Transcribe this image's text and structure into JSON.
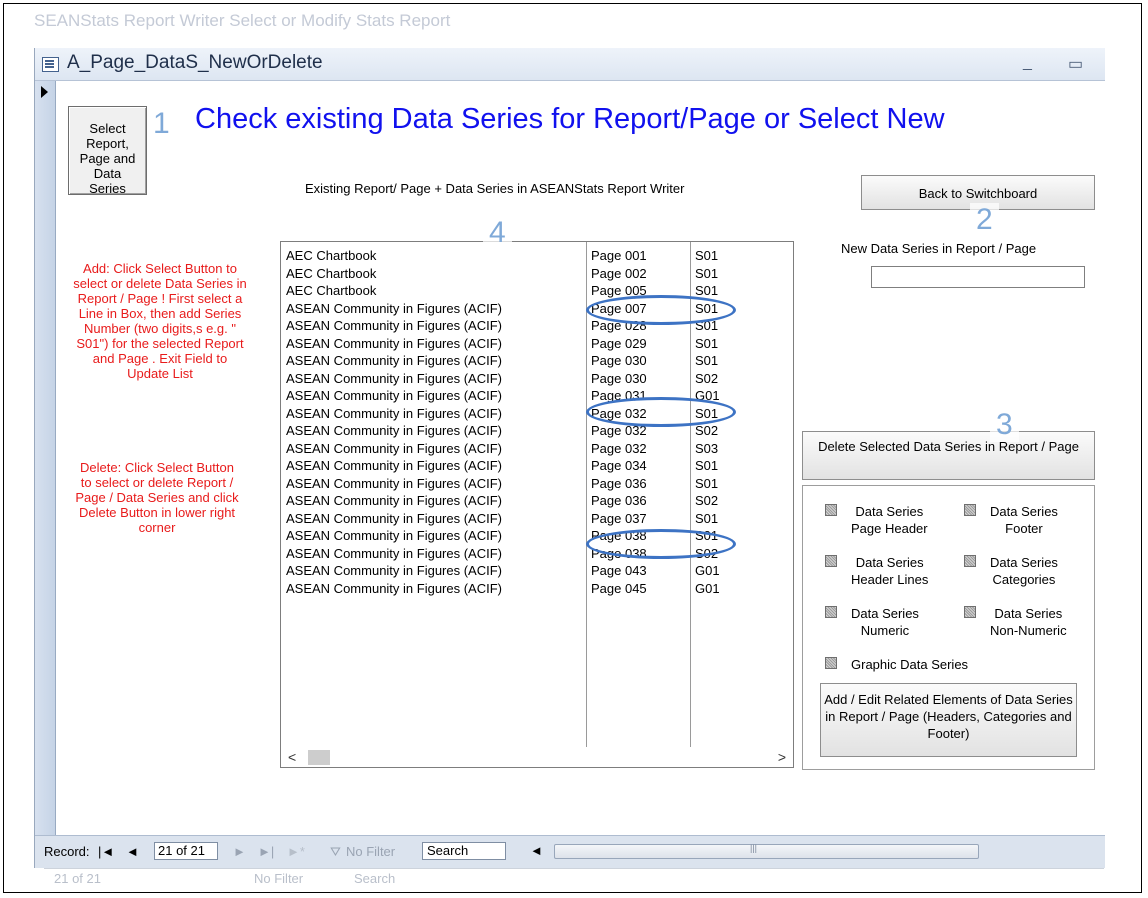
{
  "background": {
    "app_title": "SEANStats Report Writer Select or Modify Stats Report",
    "nav_record": "21 of 21",
    "nav_filter": "No Filter",
    "nav_search": "Search"
  },
  "window": {
    "title": "A_Page_DataS_NewOrDelete",
    "minimize_symbol": "_",
    "maximize_symbol": "▭"
  },
  "form": {
    "select_button_lines": [
      "Select",
      "Report,",
      "Page and",
      "Data",
      "Series"
    ],
    "main_heading": "Check existing Data Series for Report/Page or Select New",
    "subheading": "Existing Report/ Page + Data Series in ASEANStats Report Writer",
    "back_button": "Back to Switchboard",
    "new_series_label": "New  Data Series in Report / Page",
    "new_series_value": "",
    "add_instructions": "Add:  Click Select Button to  select or delete  Data Series in Report / Page ! First select a Line in Box, then add Series Number (two digits,s e.g. \" S01\")  for the selected Report and Page . Exit Field to Update List",
    "delete_instructions": "Delete: Click Select Button to  select or delete Report / Page / Data Series and click Delete Button in lower right corner",
    "delete_button": "Delete Selected Data Series in Report / Page",
    "add_edit_button": "Add / Edit Related Elements of  Data Series in Report / Page (Headers, Categories and Footer)"
  },
  "annotations": [
    "1",
    "2",
    "3",
    "4"
  ],
  "list": {
    "rows": [
      {
        "report": "AEC Chartbook",
        "page": "Page 001",
        "series": "S01"
      },
      {
        "report": "AEC Chartbook",
        "page": "Page 002",
        "series": "S01"
      },
      {
        "report": "AEC Chartbook",
        "page": "Page 005",
        "series": "S01"
      },
      {
        "report": "ASEAN Community in Figures (ACIF)",
        "page": "Page 007",
        "series": "S01"
      },
      {
        "report": "ASEAN Community in Figures (ACIF)",
        "page": "Page 028",
        "series": "S01"
      },
      {
        "report": "ASEAN Community in Figures (ACIF)",
        "page": "Page 029",
        "series": "S01"
      },
      {
        "report": "ASEAN Community in Figures (ACIF)",
        "page": "Page 030",
        "series": "S01"
      },
      {
        "report": "ASEAN Community in Figures (ACIF)",
        "page": "Page 030",
        "series": "S02"
      },
      {
        "report": "ASEAN Community in Figures (ACIF)",
        "page": "Page 031",
        "series": "G01"
      },
      {
        "report": "ASEAN Community in Figures (ACIF)",
        "page": "Page 032",
        "series": "S01"
      },
      {
        "report": "ASEAN Community in Figures (ACIF)",
        "page": "Page 032",
        "series": "S02"
      },
      {
        "report": "ASEAN Community in Figures (ACIF)",
        "page": "Page 032",
        "series": "S03"
      },
      {
        "report": "ASEAN Community in Figures (ACIF)",
        "page": "Page 034",
        "series": "S01"
      },
      {
        "report": "ASEAN Community in Figures (ACIF)",
        "page": "Page 036",
        "series": "S01"
      },
      {
        "report": "ASEAN Community in Figures (ACIF)",
        "page": "Page 036",
        "series": "S02"
      },
      {
        "report": "ASEAN Community in Figures (ACIF)",
        "page": "Page 037",
        "series": "S01"
      },
      {
        "report": "ASEAN Community in Figures (ACIF)",
        "page": "Page 038",
        "series": "S01"
      },
      {
        "report": "ASEAN Community in Figures (ACIF)",
        "page": "Page 038",
        "series": "S02"
      },
      {
        "report": "ASEAN Community in Figures (ACIF)",
        "page": "Page 043",
        "series": "G01"
      },
      {
        "report": "ASEAN Community in Figures (ACIF)",
        "page": "Page 045",
        "series": "G01"
      }
    ],
    "highlighted_rows": [
      3,
      8,
      16
    ],
    "highlight_color": "#3d73c4",
    "scroll_left": "<",
    "scroll_right": ">"
  },
  "checkboxes": [
    {
      "label": "Data Series Page Header",
      "lines": [
        "Data Series",
        "Page Header"
      ],
      "checked": true
    },
    {
      "label": "Data Series Footer",
      "lines": [
        "Data Series",
        "Footer"
      ],
      "checked": true
    },
    {
      "label": "Data Series Header Lines",
      "lines": [
        "Data Series",
        "Header Lines"
      ],
      "checked": true
    },
    {
      "label": "Data Series Categories",
      "lines": [
        "Data Series",
        "Categories"
      ],
      "checked": true
    },
    {
      "label": "Data Series Numeric",
      "lines": [
        "Data Series",
        "Numeric"
      ],
      "checked": true
    },
    {
      "label": "Data Series Non-Numeric",
      "lines": [
        "Data Series",
        "Non-Numeric"
      ],
      "checked": true
    },
    {
      "label": "Graphic Data Series",
      "lines": [
        "Graphic Data Series"
      ],
      "checked": true
    }
  ],
  "nav": {
    "record_label": "Record:",
    "first": "|◄",
    "prev": "◄",
    "record_value": "21 of 21",
    "next": "►",
    "last": "►|",
    "new": "►*",
    "filter_label": "No Filter",
    "search_label": "Search",
    "hscroll_left": "◄",
    "hscroll_grip": "|||"
  },
  "colors": {
    "heading_blue": "#1111ee",
    "instruction_red": "#e81b1b",
    "annotation_blue": "#7fa9d8"
  }
}
